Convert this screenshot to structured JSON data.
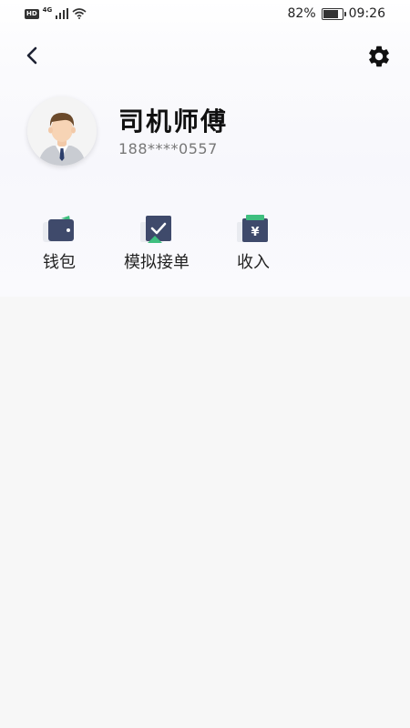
{
  "status_bar": {
    "hd": "HD",
    "network": "4G",
    "battery_percent": "82%",
    "battery_level": 0.82,
    "time": "09:26"
  },
  "nav": {
    "back_icon": "chevron-left-icon",
    "settings_icon": "gear-icon"
  },
  "profile": {
    "name": "司机师傅",
    "phone": "188****0557",
    "avatar_icon": "driver-avatar"
  },
  "actions": [
    {
      "label": "钱包",
      "icon": "wallet-icon"
    },
    {
      "label": "模拟接单",
      "icon": "order-check-icon"
    },
    {
      "label": "收入",
      "icon": "income-yen-icon"
    }
  ],
  "colors": {
    "icon_dark": "#3f4a6b",
    "icon_green": "#3fbf7f",
    "background": "#f7f7f7"
  }
}
